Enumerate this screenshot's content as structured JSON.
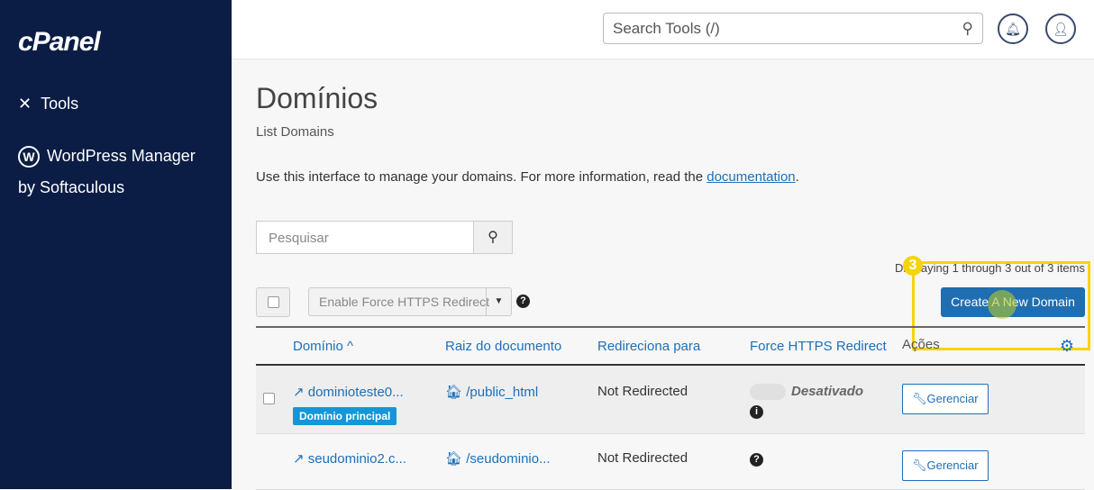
{
  "sidebar": {
    "logo": "cPanel",
    "items": [
      {
        "label": "Tools",
        "icon": "tools-icon"
      },
      {
        "label": "WordPress Manager",
        "label2": "by Softaculous",
        "icon": "wordpress-icon"
      }
    ]
  },
  "header": {
    "search_placeholder": "Search Tools (/)"
  },
  "page": {
    "title": "Domínios",
    "subtitle": "List Domains",
    "desc": "Use this interface to manage your domains. For more information, read the ",
    "doc_link": "documentation",
    "desc_end": "."
  },
  "search": {
    "placeholder": "Pesquisar"
  },
  "count": "Displaying 1 through 3 out of 3 items",
  "bulk_action": "Enable Force HTTPS Redirect",
  "create_label": "Create A New Domain",
  "step_badge": "3",
  "columns": [
    "Domínio",
    "Raiz do documento",
    "Redireciona para",
    "Force HTTPS Redirect",
    "Ações"
  ],
  "rows": [
    {
      "domain": "dominioteste0...",
      "badge": "Domínio principal",
      "root": "/public_html",
      "redirect": "Not Redirected",
      "https": "Desativado",
      "action": "Gerenciar"
    },
    {
      "domain": "seudominio2.c...",
      "root": "/seudominio...",
      "redirect": "Not Redirected",
      "action": "Gerenciar"
    }
  ],
  "colors": {
    "sidebar": "#0b1d45",
    "accent": "#1f6eb1",
    "highlight": "#f5d40c"
  }
}
